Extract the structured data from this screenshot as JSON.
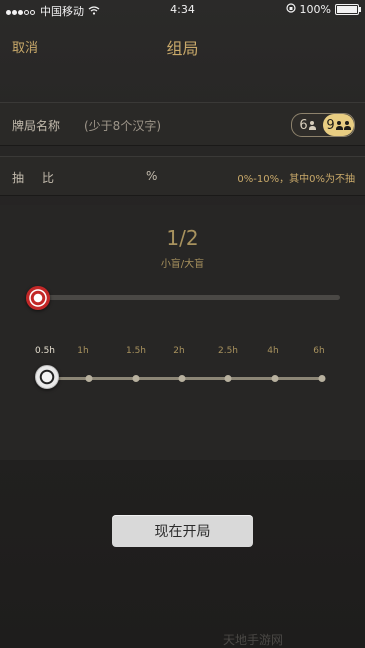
{
  "status_bar": {
    "carrier": "中国移动",
    "time": "4:34",
    "battery": "100%"
  },
  "nav": {
    "cancel_label": "取消",
    "title": "组局"
  },
  "table_name": {
    "label": "牌局名称",
    "placeholder": "(少于8个汉字)"
  },
  "seats": {
    "options": [
      "6",
      "9"
    ],
    "selected": "9"
  },
  "rake": {
    "label": "抽比",
    "unit": "%",
    "hint": "0%-10%，其中0%为不抽"
  },
  "blinds": {
    "value": "1/2",
    "caption": "小盲/大盲",
    "slider_level": 0
  },
  "duration": {
    "options": [
      "0.5h",
      "1h",
      "1.5h",
      "2h",
      "2.5h",
      "4h",
      "6h"
    ],
    "selected": "0.5h"
  },
  "start_button_label": "现在开局",
  "watermark": "天地手游网",
  "colors": {
    "accent_gold": "#c9a96a",
    "toggle_active": "#e8cd82",
    "chip_red": "#c22727"
  }
}
